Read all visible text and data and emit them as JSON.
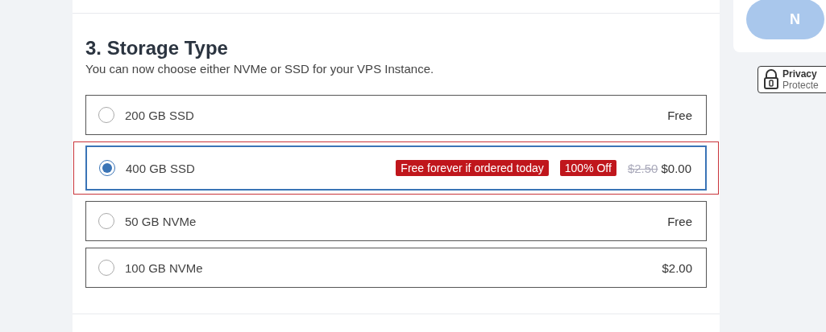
{
  "section": {
    "title": "3. Storage Type",
    "subtitle": "You can now choose either NVMe or SSD for your VPS Instance."
  },
  "options": [
    {
      "label": "200 GB SSD",
      "selected": false,
      "highlighted": false,
      "price": "Free"
    },
    {
      "label": "400 GB SSD",
      "selected": true,
      "highlighted": true,
      "badges": [
        "Free forever if ordered today",
        "100% Off"
      ],
      "old_price": "$2.50",
      "price": "$0.00"
    },
    {
      "label": "50 GB NVMe",
      "selected": false,
      "highlighted": false,
      "price": "Free"
    },
    {
      "label": "100 GB NVMe",
      "selected": false,
      "highlighted": false,
      "price": "$2.00"
    }
  ],
  "sidebar": {
    "button": "N",
    "privacy": {
      "title": "Privacy",
      "subtitle": "Protecte"
    }
  }
}
